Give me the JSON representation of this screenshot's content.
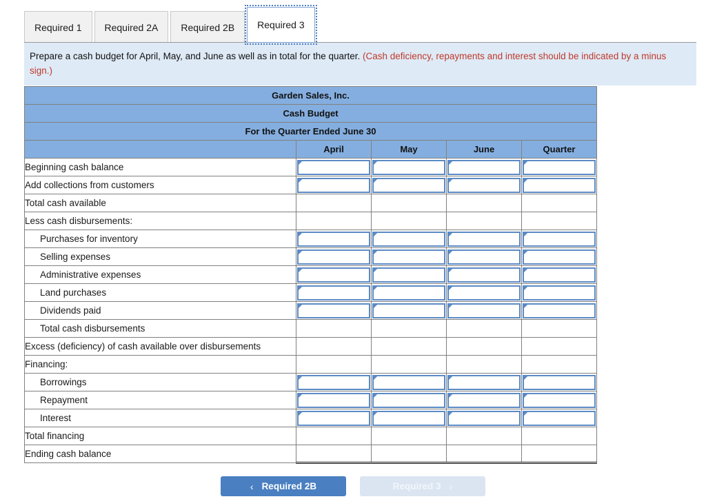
{
  "tabs": [
    {
      "label": "Required 1",
      "active": false
    },
    {
      "label": "Required 2A",
      "active": false
    },
    {
      "label": "Required 2B",
      "active": false
    },
    {
      "label": "Required 3",
      "active": true
    }
  ],
  "banner": {
    "text": "Prepare a cash budget for April, May, and June as well as in total for the quarter. ",
    "note": "(Cash deficiency, repayments and interest should be indicated by a minus sign.)"
  },
  "table": {
    "title_lines": [
      "Garden Sales, Inc.",
      "Cash Budget",
      "For the Quarter Ended June 30"
    ],
    "column_headers": [
      "",
      "April",
      "May",
      "June",
      "Quarter"
    ],
    "rows": [
      {
        "label": "Beginning cash balance",
        "indent": false,
        "type": "input",
        "values": [
          "",
          "",
          "",
          ""
        ]
      },
      {
        "label": "Add collections from customers",
        "indent": false,
        "type": "input",
        "values": [
          "",
          "",
          "",
          ""
        ]
      },
      {
        "label": "Total cash available",
        "indent": false,
        "type": "plain",
        "rule_top": true,
        "values": [
          "",
          "",
          "",
          ""
        ]
      },
      {
        "label": "Less cash disbursements:",
        "indent": false,
        "type": "plain",
        "rule_top": true,
        "values": [
          "",
          "",
          "",
          ""
        ]
      },
      {
        "label": "Purchases for inventory",
        "indent": true,
        "type": "input",
        "values": [
          "",
          "",
          "",
          ""
        ]
      },
      {
        "label": "Selling expenses",
        "indent": true,
        "type": "input",
        "values": [
          "",
          "",
          "",
          ""
        ]
      },
      {
        "label": "Administrative expenses",
        "indent": true,
        "type": "input",
        "values": [
          "",
          "",
          "",
          ""
        ]
      },
      {
        "label": "Land purchases",
        "indent": true,
        "type": "input",
        "values": [
          "",
          "",
          "",
          ""
        ]
      },
      {
        "label": "Dividends paid",
        "indent": true,
        "type": "input",
        "values": [
          "",
          "",
          "",
          ""
        ]
      },
      {
        "label": "Total cash disbursements",
        "indent": true,
        "type": "plain",
        "rule_top": true,
        "values": [
          "",
          "",
          "",
          ""
        ]
      },
      {
        "label": "Excess (deficiency) of cash available over disbursements",
        "indent": false,
        "type": "plain",
        "rule_top": true,
        "values": [
          "",
          "",
          "",
          ""
        ]
      },
      {
        "label": "Financing:",
        "indent": false,
        "type": "plain",
        "rule_top": true,
        "values": [
          "",
          "",
          "",
          ""
        ]
      },
      {
        "label": "Borrowings",
        "indent": true,
        "type": "input",
        "values": [
          "",
          "",
          "",
          ""
        ]
      },
      {
        "label": "Repayment",
        "indent": true,
        "type": "input",
        "values": [
          "",
          "",
          "",
          ""
        ]
      },
      {
        "label": "Interest",
        "indent": true,
        "type": "input",
        "values": [
          "",
          "",
          "",
          ""
        ]
      },
      {
        "label": "Total financing",
        "indent": false,
        "type": "plain",
        "rule_top": true,
        "values": [
          "",
          "",
          "",
          ""
        ]
      },
      {
        "label": "Ending cash balance",
        "indent": false,
        "type": "plain",
        "rule_top": true,
        "double_bottom": true,
        "values": [
          "",
          "",
          "",
          ""
        ]
      }
    ]
  },
  "nav": {
    "prev_label": "Required 2B",
    "prev_chevron": "‹",
    "next_label": "Required 3",
    "next_chevron": "›"
  },
  "colors": {
    "header_blue": "#84aedf",
    "banner_blue": "#deeaf6",
    "input_border": "#5b8ac5",
    "note_red": "#c0392b",
    "btn_primary": "#4a7fc1",
    "btn_disabled": "#dbe5f1"
  }
}
